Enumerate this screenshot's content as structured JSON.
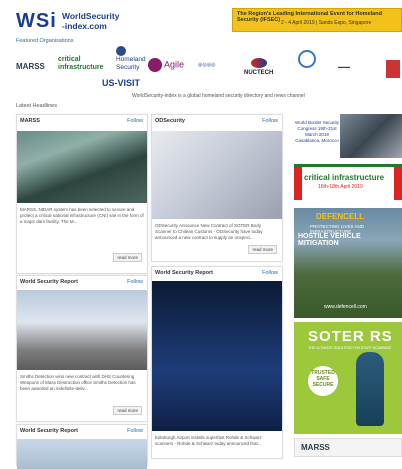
{
  "header": {
    "logo_mark": "WSi",
    "logo_line1": "WorldSecurity",
    "logo_line2": "-index.com",
    "banner_line1": "The Region's Leading International Event for Homeland Security (IFSEC)",
    "banner_line2": "2 - 4 April 2019 | Sands Expo, Singapore"
  },
  "featured": {
    "label": "Featured Organisations",
    "orgs": [
      "MARSS",
      "critical infrastructure",
      "Homeland Security",
      "US-VISIT",
      "Agile",
      "NUCTECH"
    ]
  },
  "tagline": "WorldSecurity-index is a global homeland security directory and news channel",
  "headlines_label": "Latest Headlines",
  "cards": [
    {
      "source": "MARSS",
      "follow": "Follow",
      "text": "MARSS, NIDAR system has been selected to secure and protect a critical national infrastructure (CNI) site in the form of a major dam facility. The M...",
      "more": "read more"
    },
    {
      "source": "ODSecurity",
      "follow": "Follow",
      "text": "ODSecurity Announce New Contract of SOTER Body Scanner to Chilean Customs - ODSecurity have today announced a new contract to supply an unspeci...",
      "more": "read more"
    },
    {
      "source": "World Security Report",
      "follow": "Follow",
      "text": "Smiths Detection wins new contract with DHS Countering Weapons of Mass Destruction office Smiths Detection has been awarded an indefinite-deliv...",
      "more": "read more"
    },
    {
      "source": "World Security Report",
      "follow": "Follow",
      "text": "Edinburgh Airport installs superfast Rohde & Schwarz scanners - Rohde & Schwarz today announced that..."
    },
    {
      "source": "World Security Report",
      "follow": "Follow"
    }
  ],
  "ads": {
    "wbsc": "World Border Security Congress 19th-21st March 2019 Casablanca, Morocco",
    "cip_title": "critical infrastructure",
    "cip_sub": "16th-18th April 2019",
    "defencell_title": "DEFENCELL",
    "defencell_sub": "PROTECTING LIVES AND INFRASTRUCTURE",
    "defencell_tag": "HOSTILE VEHICLE MITIGATION",
    "defencell_url": "www.defencell.com",
    "soter_title": "SOTER RS",
    "soter_sub": "THE ULTIMATE SOLUTION FOR STAFF SCANNING",
    "soter_badge": "TRUSTED SAFE SECURE",
    "marss": "MARSS"
  }
}
